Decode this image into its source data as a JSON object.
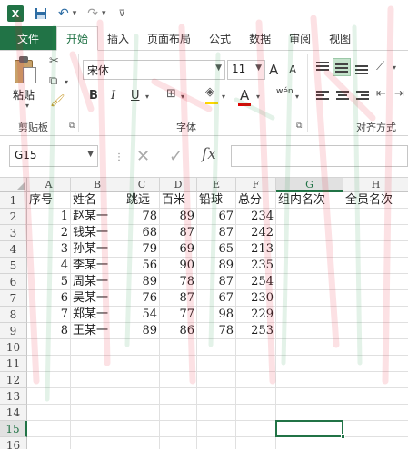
{
  "titlebar": {
    "logo": "X",
    "icons": [
      "excel-logo-icon",
      "save-icon",
      "undo-icon",
      "redo-icon",
      "customize-icon"
    ]
  },
  "tabs": [
    {
      "label": "文件"
    },
    {
      "label": "开始"
    },
    {
      "label": "插入"
    },
    {
      "label": "页面布局"
    },
    {
      "label": "公式"
    },
    {
      "label": "数据"
    },
    {
      "label": "审阅"
    },
    {
      "label": "视图"
    }
  ],
  "ribbon": {
    "paste_label": "粘贴",
    "clipboard_group": "剪贴板",
    "font_group": "字体",
    "align_group": "对齐方式",
    "font_name": "宋体",
    "font_size": "11",
    "bold": "B",
    "italic": "I",
    "underline": "U",
    "grow_font": "A",
    "shrink_font": "A",
    "font_color": "A",
    "wen": "wén",
    "fill_color": "#ffd700",
    "text_color": "#e00000"
  },
  "formula_bar": {
    "name_box": "G15",
    "fx_label": "fx",
    "value": ""
  },
  "sheet": {
    "columns": [
      "A",
      "B",
      "C",
      "D",
      "E",
      "F",
      "G",
      "H"
    ],
    "selected_column": "G",
    "selected_row": "15",
    "row_numbers": [
      "1",
      "2",
      "3",
      "4",
      "5",
      "6",
      "7",
      "8",
      "9",
      "10",
      "11",
      "12",
      "13",
      "14",
      "15",
      "16"
    ],
    "header_row": [
      "序号",
      "姓名",
      "跳远",
      "百米",
      "铅球",
      "总分",
      "组内名次",
      "全员名次"
    ],
    "rows": [
      [
        "1",
        "赵某一",
        "78",
        "89",
        "67",
        "234"
      ],
      [
        "2",
        "钱某一",
        "68",
        "87",
        "87",
        "242"
      ],
      [
        "3",
        "孙某一",
        "79",
        "69",
        "65",
        "213"
      ],
      [
        "4",
        "李某一",
        "56",
        "90",
        "89",
        "235"
      ],
      [
        "5",
        "周某一",
        "89",
        "78",
        "87",
        "254"
      ],
      [
        "6",
        "吴某一",
        "76",
        "87",
        "67",
        "230"
      ],
      [
        "7",
        "郑某一",
        "54",
        "77",
        "98",
        "229"
      ],
      [
        "8",
        "王某一",
        "89",
        "86",
        "78",
        "253"
      ]
    ]
  },
  "colors": {
    "accent": "#217346",
    "watermark_red": "#e8192c",
    "watermark_green": "#2a9d4a"
  }
}
